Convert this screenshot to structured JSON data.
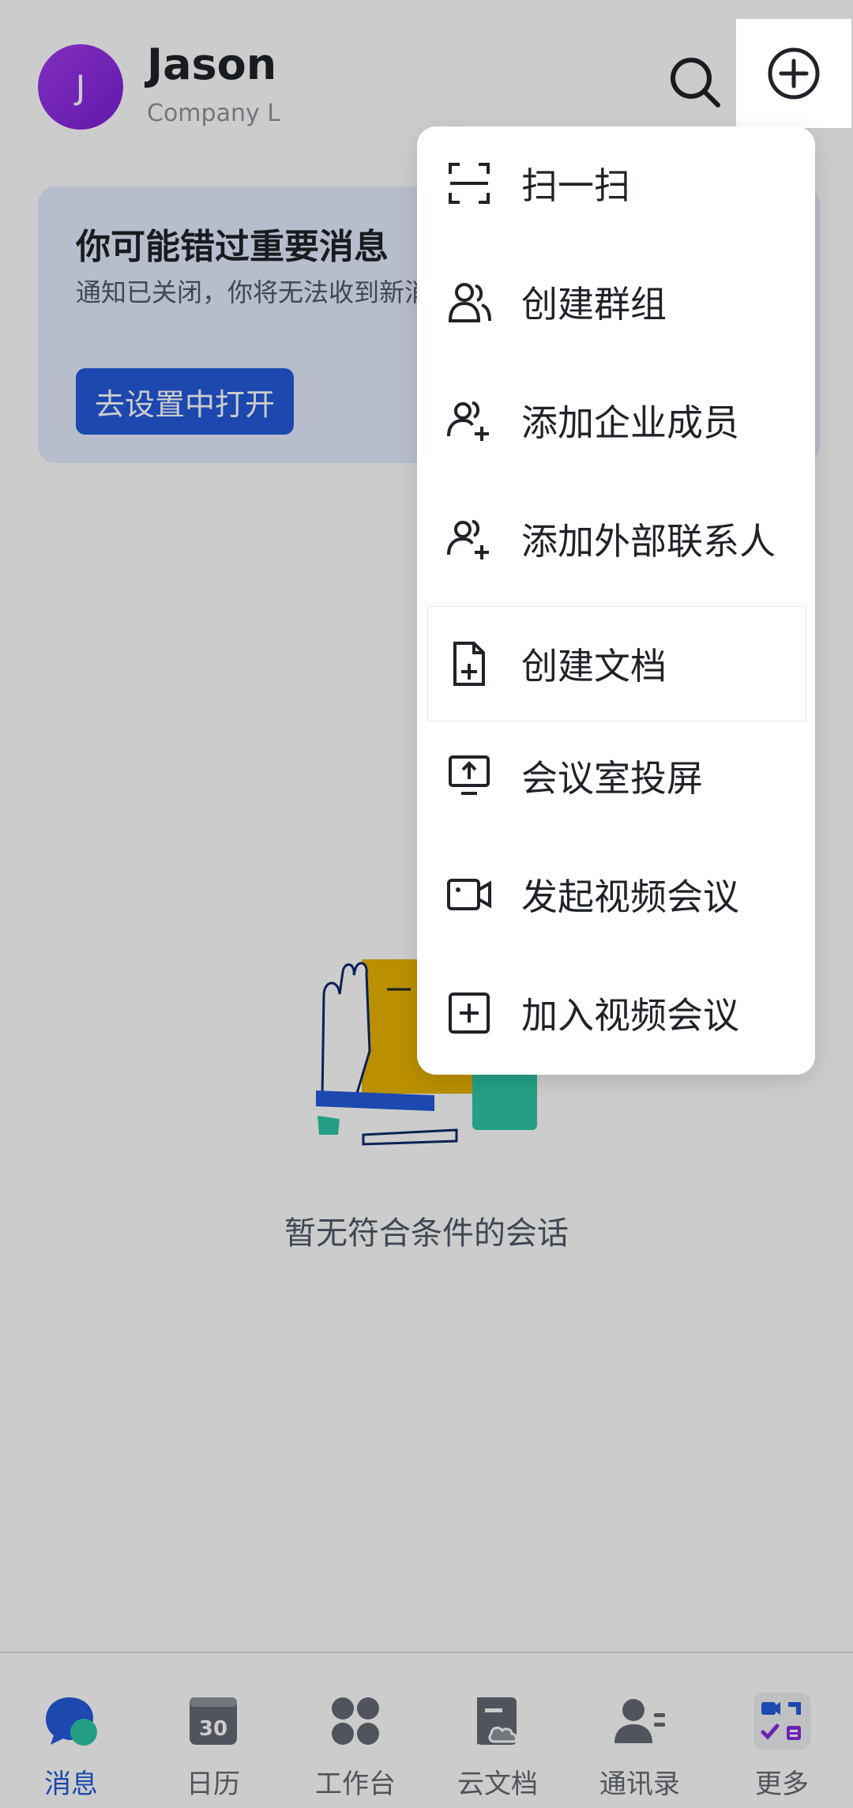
{
  "header": {
    "avatar_letter": "J",
    "user_name": "Jason",
    "company": "Company L"
  },
  "notice": {
    "title": "你可能错过重要消息",
    "description": "通知已关闭，你将无法收到新消息通知",
    "button_label": "去设置中打开"
  },
  "empty_state": {
    "text": "暂无符合条件的会话"
  },
  "menu": {
    "items": [
      {
        "label": "扫一扫",
        "icon": "scan-icon"
      },
      {
        "label": "创建群组",
        "icon": "group-icon"
      },
      {
        "label": "添加企业成员",
        "icon": "add-users-icon"
      },
      {
        "label": "添加外部联系人",
        "icon": "add-external-contact-icon"
      },
      {
        "label": "创建文档",
        "icon": "new-document-icon"
      },
      {
        "label": "会议室投屏",
        "icon": "screen-share-icon"
      },
      {
        "label": "发起视频会议",
        "icon": "video-camera-icon"
      },
      {
        "label": "加入视频会议",
        "icon": "join-meeting-icon"
      }
    ]
  },
  "tabs": [
    {
      "label": "消息",
      "active": true
    },
    {
      "label": "日历",
      "calendar_day": "30"
    },
    {
      "label": "工作台"
    },
    {
      "label": "云文档"
    },
    {
      "label": "通讯录"
    },
    {
      "label": "更多"
    }
  ],
  "colors": {
    "accent": "#245bdb",
    "avatar": "#8a2be2",
    "notice_bg": "#e5edff"
  }
}
